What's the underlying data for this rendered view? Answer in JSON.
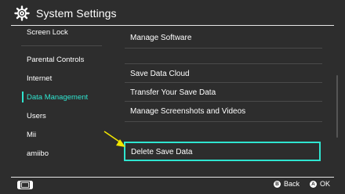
{
  "header": {
    "title": "System Settings",
    "icon": "gear-icon"
  },
  "sidebar": {
    "items": [
      {
        "label": "Screen Lock",
        "active": false
      },
      {
        "label": "Parental Controls",
        "active": false
      },
      {
        "label": "Internet",
        "active": false
      },
      {
        "label": "Data Management",
        "active": true
      },
      {
        "label": "Users",
        "active": false
      },
      {
        "label": "Mii",
        "active": false
      },
      {
        "label": "amiibo",
        "active": false
      }
    ]
  },
  "main": {
    "items": [
      {
        "label": "Manage Software"
      },
      {
        "label": "Save Data Cloud"
      },
      {
        "label": "Transfer Your Save Data"
      },
      {
        "label": "Manage Screenshots and Videos"
      },
      {
        "label": "Delete Save Data",
        "selected": true
      }
    ]
  },
  "footer": {
    "back_glyph": "B",
    "back_label": "Back",
    "ok_glyph": "A",
    "ok_label": "OK"
  },
  "colors": {
    "accent": "#2fe5d0",
    "background": "#2d2d2d",
    "arrow": "#f2e600"
  }
}
